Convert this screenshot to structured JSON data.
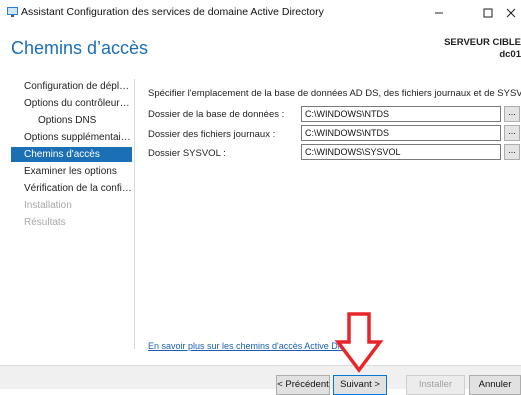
{
  "window": {
    "title": "Assistant Configuration des services de domaine Active Directory",
    "controls": [
      "minimize-icon",
      "maximize-icon",
      "close-icon"
    ]
  },
  "header": {
    "page_title": "Chemins d’accès",
    "server_label": "SERVEUR CIBLE",
    "server_name": "dc01"
  },
  "nav": {
    "items": [
      {
        "label": "Configuration de déploiement",
        "state": "normal"
      },
      {
        "label": "Options du contrôleur de domaine",
        "state": "normal"
      },
      {
        "label": "Options DNS",
        "state": "normal"
      },
      {
        "label": "Options supplémentaires",
        "state": "normal"
      },
      {
        "label": "Chemins d'accès",
        "state": "active"
      },
      {
        "label": "Examiner les options",
        "state": "normal"
      },
      {
        "label": "Vérification de la configuration requise",
        "state": "normal"
      },
      {
        "label": "Installation",
        "state": "disabled"
      },
      {
        "label": "Résultats",
        "state": "disabled"
      }
    ]
  },
  "main": {
    "instruction": "Spécifier l'emplacement de la base de données AD DS, des fichiers journaux et de SYSVOL",
    "fields": [
      {
        "label": "Dossier de la base de données :",
        "value": "C:\\WINDOWS\\NTDS",
        "button": "..."
      },
      {
        "label": "Dossier des fichiers journaux :",
        "value": "C:\\WINDOWS\\NTDS",
        "button": "..."
      },
      {
        "label": "Dossier SYSVOL :",
        "value": "C:\\WINDOWS\\SYSVOL",
        "button": "..."
      }
    ],
    "learn_more": "En savoir plus sur les chemins d'accès Active Directory"
  },
  "footer": {
    "previous": "< Précédent",
    "next": "Suivant >",
    "install": "Installer",
    "cancel": "Annuler"
  },
  "annotation": {
    "color": "#e8262a"
  },
  "colors": {
    "accent": "#1a6fb5"
  }
}
